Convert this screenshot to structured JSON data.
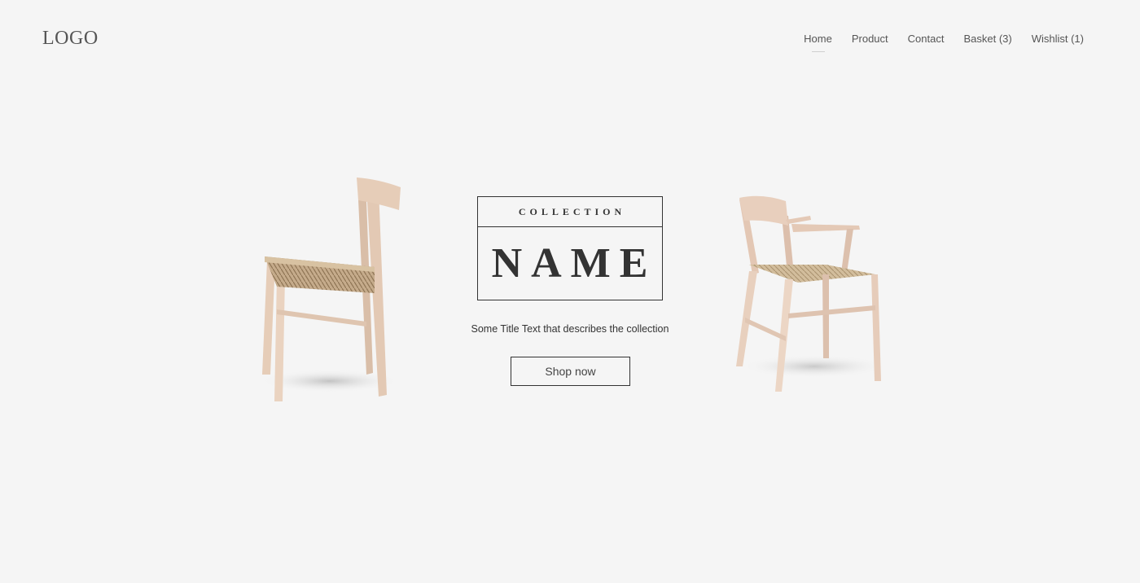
{
  "header": {
    "logo": "LOGO",
    "nav": [
      {
        "label": "Home",
        "active": true
      },
      {
        "label": "Product",
        "active": false
      },
      {
        "label": "Contact",
        "active": false
      },
      {
        "label": "Basket (3)",
        "active": false
      },
      {
        "label": "Wishlist (1)",
        "active": false
      }
    ]
  },
  "hero": {
    "collection_label": "COLLECTION",
    "collection_name": "NAME",
    "tagline": "Some Title Text that describes the collection",
    "cta_label": "Shop now",
    "images": [
      "chair-side-image",
      "armchair-image"
    ]
  },
  "colors": {
    "background": "#f5f5f5",
    "text": "#333333",
    "wood": "#e6cdb8",
    "seat_weave": "#b79b78"
  }
}
